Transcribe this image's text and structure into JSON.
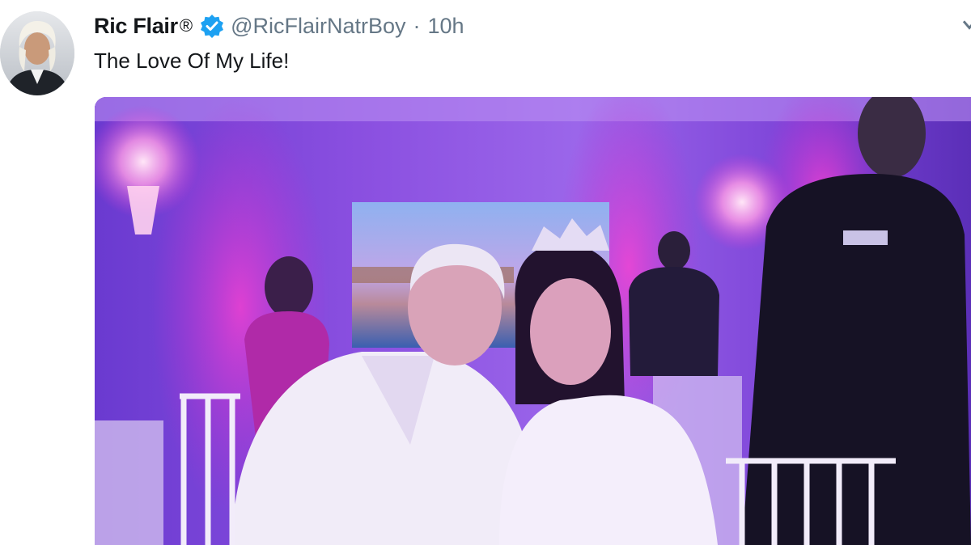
{
  "tweet": {
    "author_name": "Ric Flair",
    "registered_mark": "®",
    "handle": "@RicFlairNatrBoy",
    "separator": "·",
    "timestamp": "10h",
    "text": "The Love Of My Life!"
  },
  "icons": {
    "avatar": "profile-photo",
    "verified": "verified-badge-icon",
    "more": "chevron-down-icon",
    "media": "photo-couple-at-party"
  },
  "colors": {
    "name": "#14171a",
    "secondary": "#657786",
    "verified": "#1da1f2",
    "photo_tint": "#7b3fd6"
  }
}
